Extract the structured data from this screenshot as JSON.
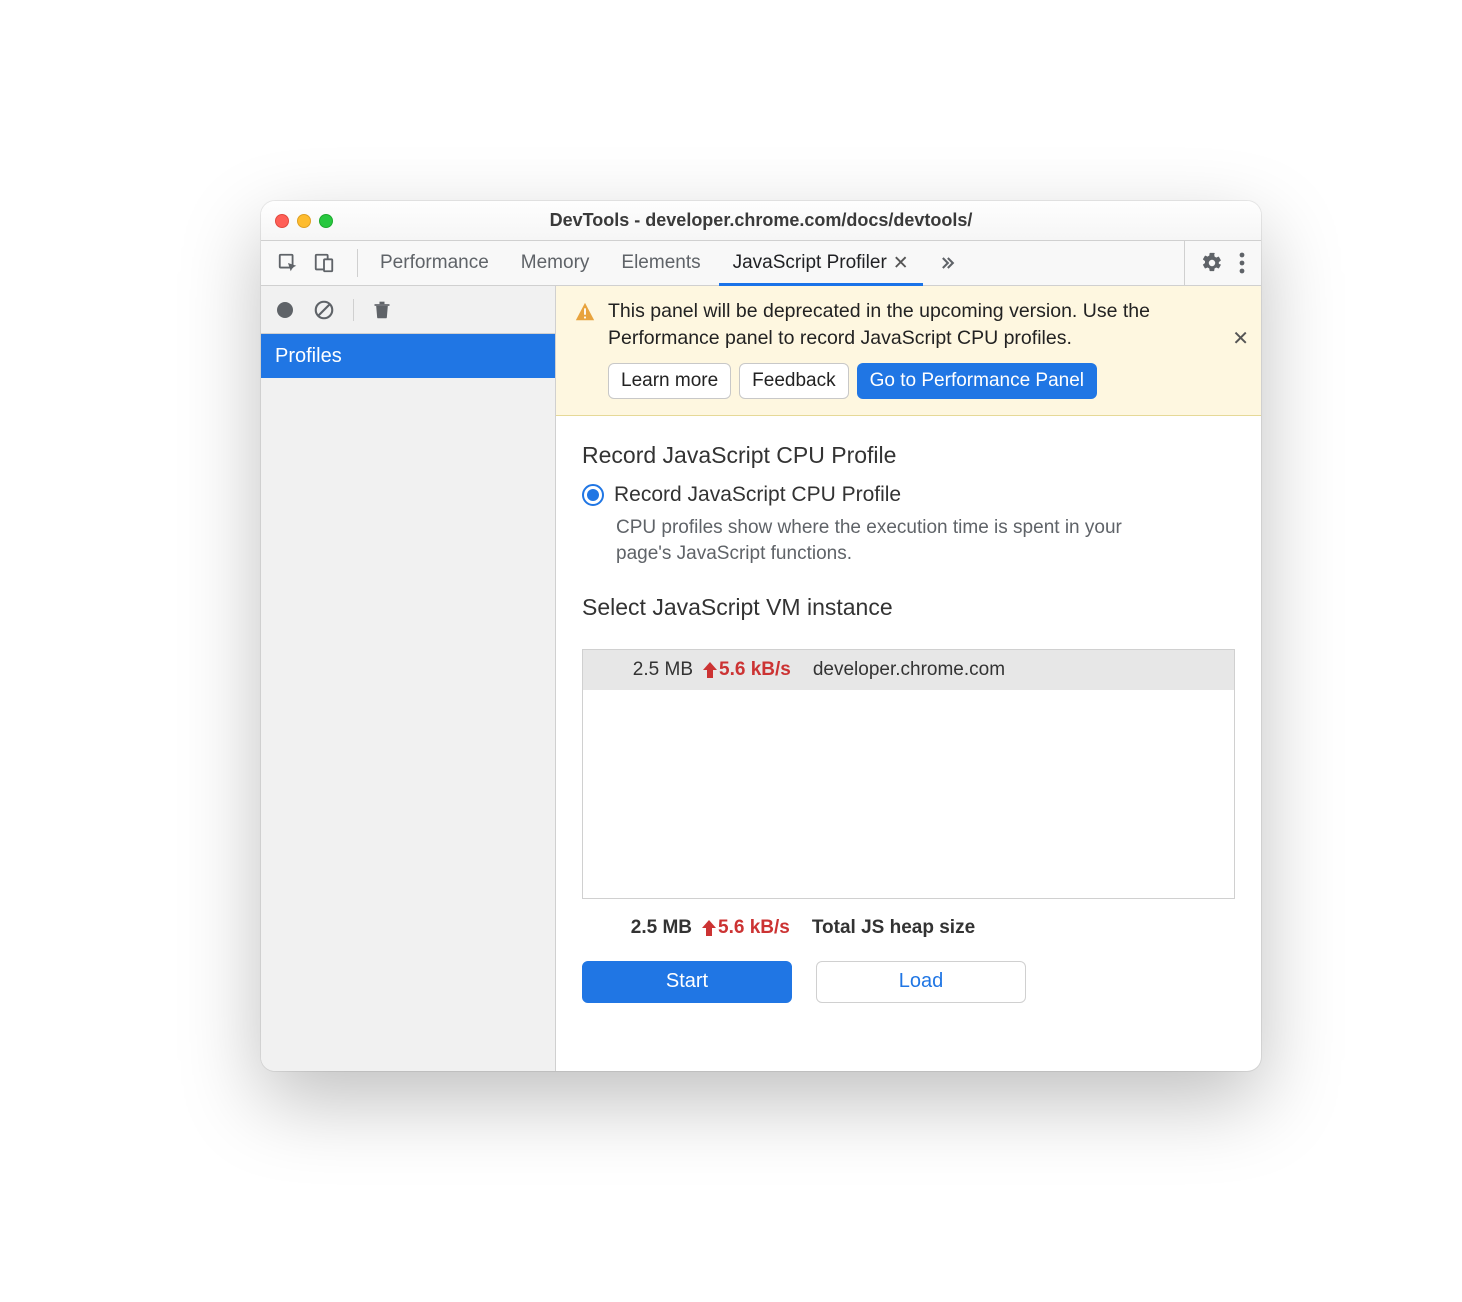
{
  "window": {
    "title": "DevTools - developer.chrome.com/docs/devtools/"
  },
  "tabs": {
    "items": [
      "Performance",
      "Memory",
      "Elements",
      "JavaScript Profiler"
    ],
    "activeIndex": 3
  },
  "sidebar": {
    "items": [
      {
        "label": "Profiles"
      }
    ]
  },
  "banner": {
    "text": "This panel will be deprecated in the upcoming version. Use the Performance panel to record JavaScript CPU profiles.",
    "learn_more": "Learn more",
    "feedback": "Feedback",
    "go_perf": "Go to Performance Panel"
  },
  "content": {
    "heading1": "Record JavaScript CPU Profile",
    "radio_label": "Record JavaScript CPU Profile",
    "radio_desc": "CPU profiles show where the execution time is spent in your page's JavaScript functions.",
    "heading2": "Select JavaScript VM instance",
    "vm": {
      "size": "2.5 MB",
      "rate": "5.6 kB/s",
      "host": "developer.chrome.com"
    },
    "total": {
      "size": "2.5 MB",
      "rate": "5.6 kB/s",
      "label": "Total JS heap size"
    },
    "start": "Start",
    "load": "Load"
  }
}
